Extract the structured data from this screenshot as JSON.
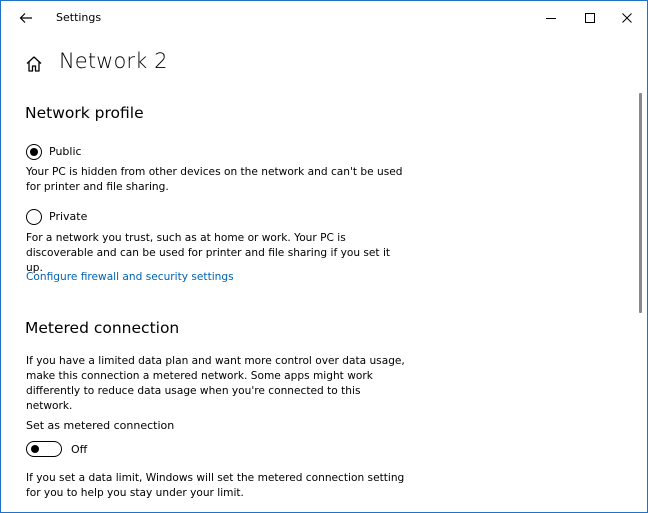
{
  "window": {
    "title": "Settings"
  },
  "page": {
    "title": "Network 2"
  },
  "network_profile": {
    "heading": "Network profile",
    "public": {
      "label": "Public",
      "selected": true,
      "description_line1": "Your PC is hidden from other devices on the network and can't be used",
      "description_line2": "for printer and file sharing."
    },
    "private": {
      "label": "Private",
      "selected": false,
      "description_line1": "For a network you trust, such as at home or work. Your PC is",
      "description_line2": "discoverable and can be used for printer and file sharing if you set it up."
    },
    "firewall_link": "Configure firewall and security settings"
  },
  "metered": {
    "heading": "Metered connection",
    "intro_line1": "If you have a limited data plan and want more control over data usage,",
    "intro_line2": "make this connection a metered network. Some apps might work",
    "intro_line3": "differently to reduce data usage when you're connected to this network.",
    "toggle_label": "Set as metered connection",
    "toggle_state": "Off",
    "toggle_on": false,
    "limit_line1": "If you set a data limit, Windows will set the metered connection setting",
    "limit_line2": "for you to help you stay under your limit."
  },
  "colors": {
    "accent": "#0063b1",
    "window_border": "#1e73c9"
  },
  "icons": {
    "back": "back-arrow-icon",
    "home": "home-icon",
    "minimize": "minimize-icon",
    "maximize": "maximize-icon",
    "close": "close-icon"
  }
}
